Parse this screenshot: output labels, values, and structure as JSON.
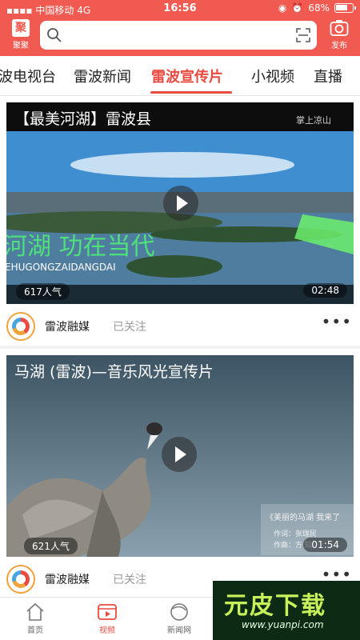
{
  "status_bar": {
    "carrier": "中国移动",
    "network": "4G",
    "time": "16:56",
    "battery": "68%"
  },
  "header": {
    "logo_label": "聚聚",
    "logo_glyph": "聚",
    "search_placeholder": "",
    "publish_label": "发布",
    "accent_color": "#f05a50"
  },
  "tabs": [
    {
      "label": "波电视台",
      "active": false
    },
    {
      "label": "雷波新闻",
      "active": false
    },
    {
      "label": "雷波宣传片",
      "active": true
    },
    {
      "label": "小视频",
      "active": false
    },
    {
      "label": "直播",
      "active": false
    }
  ],
  "feed": [
    {
      "title": "【最美河湖】雷波县",
      "overlay_caption": "河湖  功在当代",
      "overlay_sub": "EHUGONGZAIDANGDAI",
      "channel_badge": "掌上凉山",
      "views": "617人气",
      "duration": "02:48",
      "publisher": "雷波融媒",
      "follow_status": "已关注"
    },
    {
      "title": "马湖 (雷波)—音乐风光宣传片",
      "lyric_title": "《美丽的马湖 我来了",
      "lyricist": "作词：张瑞民",
      "composer": "作曲：方  知",
      "views": "621人气",
      "duration": "01:54",
      "publisher": "雷波融媒",
      "follow_status": "已关注"
    }
  ],
  "bottom_nav": [
    {
      "label": "首页",
      "icon": "home-icon",
      "active": false
    },
    {
      "label": "视频",
      "icon": "video-icon",
      "active": true
    },
    {
      "label": "新闻网",
      "icon": "news-globe-icon",
      "active": false
    }
  ],
  "watermark": {
    "text": "元皮下载",
    "url": "www.yuanpi.com"
  }
}
